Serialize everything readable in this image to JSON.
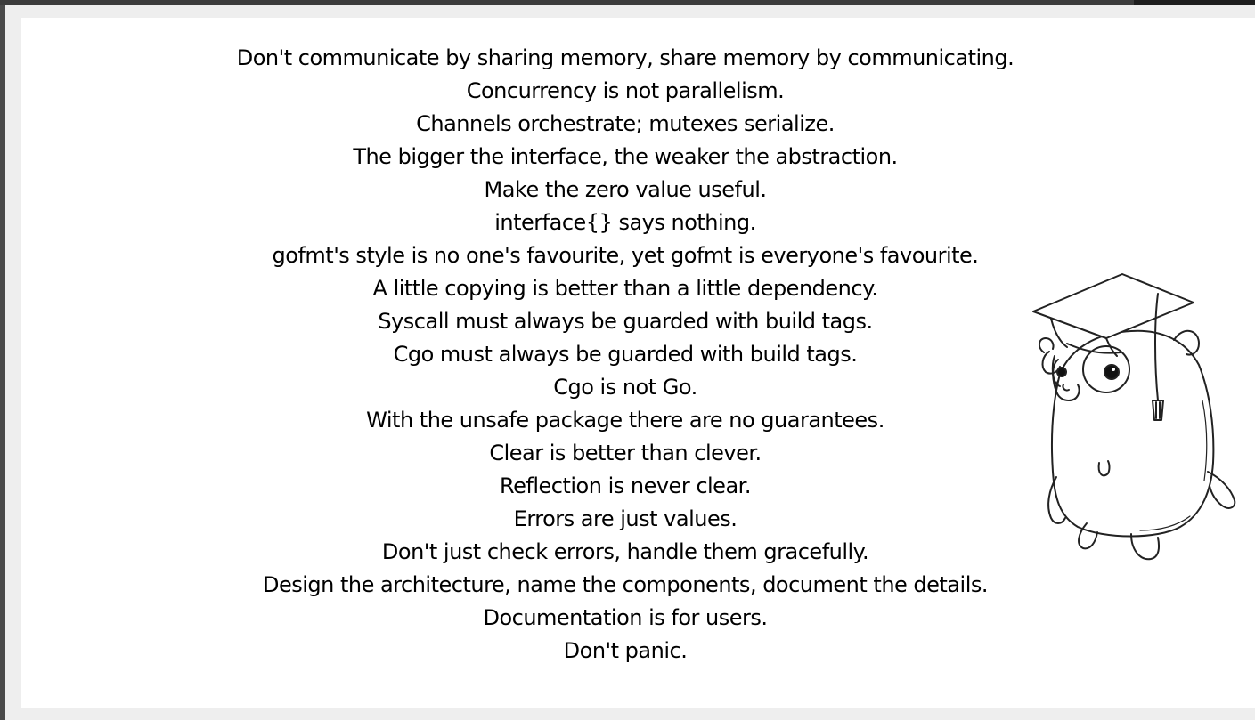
{
  "proverbs": [
    "Don't communicate by sharing memory, share memory by communicating.",
    "Concurrency is not parallelism.",
    "Channels orchestrate; mutexes serialize.",
    "The bigger the interface, the weaker the abstraction.",
    "Make the zero value useful.",
    "interface{} says nothing.",
    "gofmt's style is no one's favourite, yet gofmt is everyone's favourite.",
    "A little copying is better than a little dependency.",
    "Syscall must always be guarded with build tags.",
    "Cgo must always be guarded with build tags.",
    "Cgo is not Go.",
    "With the unsafe package there are no guarantees.",
    "Clear is better than clever.",
    "Reflection is never clear.",
    "Errors are just values.",
    "Don't just check errors, handle them gracefully.",
    "Design the architecture, name the components, document the details.",
    "Documentation is for users.",
    "Don't panic."
  ],
  "icons": {
    "illustration": "gopher-graduate-icon"
  },
  "colors": {
    "background": "#ffffff",
    "text": "#000000",
    "frame": "#4a4a4a"
  }
}
